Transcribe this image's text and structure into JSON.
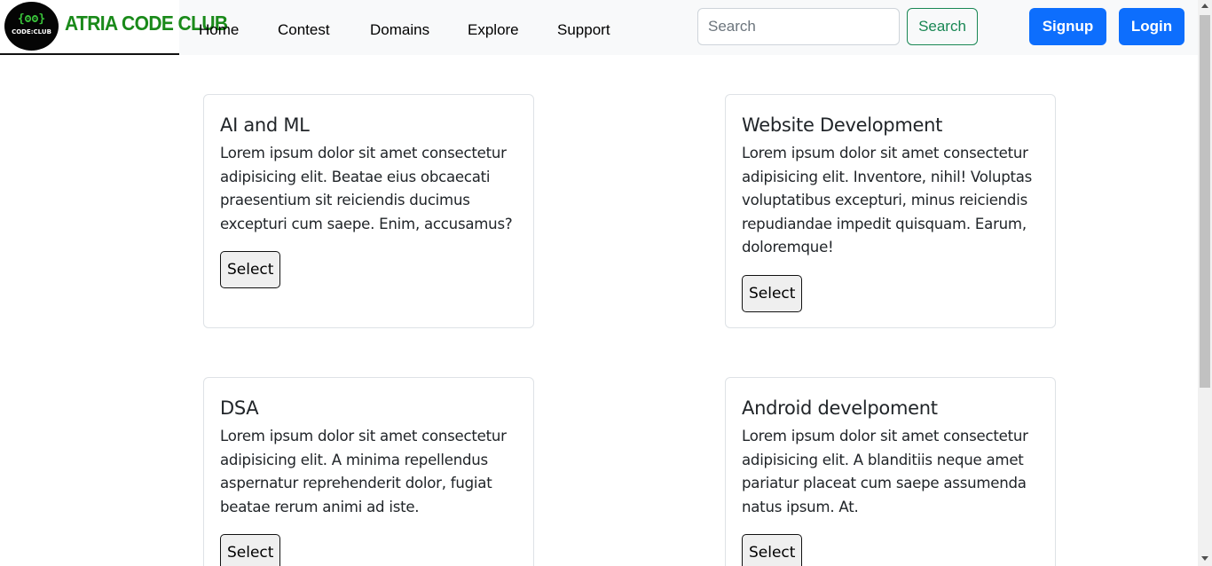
{
  "brand": {
    "logo_glyph": "{ʘʘ}",
    "logo_text": "CODE:CLUB",
    "name": "ATRIA CODE CLUB"
  },
  "nav": {
    "items": [
      {
        "label": "Home"
      },
      {
        "label": "Contest"
      },
      {
        "label": "Domains"
      },
      {
        "label": "Explore"
      },
      {
        "label": "Support"
      }
    ]
  },
  "search": {
    "placeholder": "Search",
    "value": "",
    "button_label": "Search"
  },
  "auth": {
    "signup_label": "Signup",
    "login_label": "Login"
  },
  "cards": [
    {
      "title": "AI and ML",
      "text": "Lorem ipsum dolor sit amet consectetur adipisicing elit. Beatae eius obcaecati praesentium sit reiciendis ducimus excepturi cum saepe. Enim, accusamus?",
      "button_label": "Select"
    },
    {
      "title": "Website Development",
      "text": "Lorem ipsum dolor sit amet consectetur adipisicing elit. Inventore, nihil! Voluptas voluptatibus excepturi, minus reiciendis repudiandae impedit quisquam. Earum, doloremque!",
      "button_label": "Select"
    },
    {
      "title": "DSA",
      "text": "Lorem ipsum dolor sit amet consectetur adipisicing elit. A minima repellendus aspernatur reprehenderit dolor, fugiat beatae rerum animi ad iste.",
      "button_label": "Select"
    },
    {
      "title": "Android develpoment",
      "text": "Lorem ipsum dolor sit amet consectetur adipisicing elit. A blanditiis neque amet pariatur placeat cum saepe assumenda natus ipsum. At.",
      "button_label": "Select"
    }
  ],
  "colors": {
    "brand_green": "#1a8a1a",
    "primary_blue": "#0d6efd",
    "success_green": "#198754",
    "navbar_bg": "#f8f9fa"
  }
}
